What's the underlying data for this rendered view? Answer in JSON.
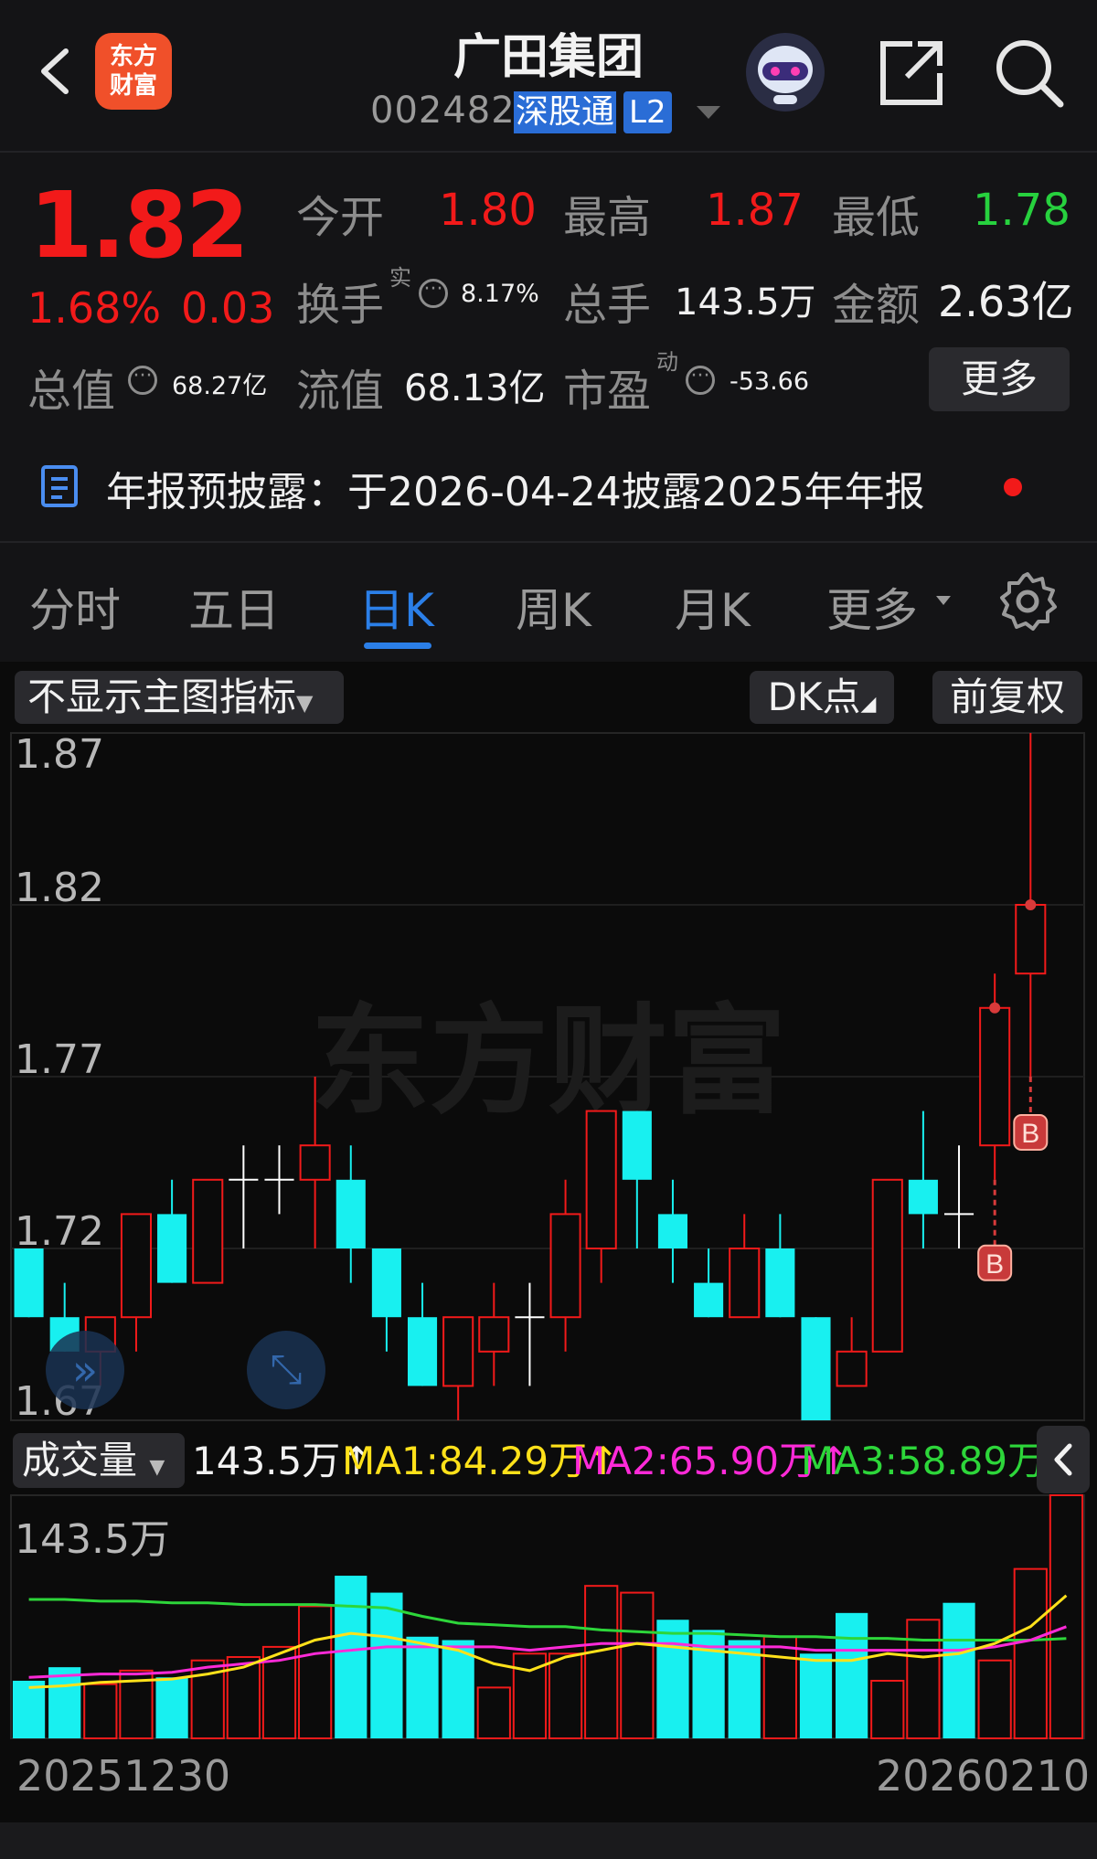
{
  "header": {
    "logo_text_1": "东方",
    "logo_text_2": "财富",
    "title": "广田集团",
    "code": "002482",
    "badge": "深股通",
    "level": "L2"
  },
  "quote": {
    "price": "1.82",
    "pct": "1.68%",
    "change": "0.03",
    "open_label": "今开",
    "open": "1.80",
    "high_label": "最高",
    "high": "1.87",
    "low_label": "最低",
    "low": "1.78",
    "turnover_label": "换手",
    "turnover_sup": "实",
    "turnover": "8.17%",
    "volume_label": "总手",
    "volume": "143.5万",
    "amount_label": "金额",
    "amount": "2.63亿",
    "mktcap_label": "总值",
    "mktcap": "68.27亿",
    "float_label": "流值",
    "float_cap": "68.13亿",
    "pe_label": "市盈",
    "pe_sup": "动",
    "pe": "-53.66",
    "more_label": "更多"
  },
  "notice": {
    "text": "年报预披露：于2026-04-24披露2025年年报"
  },
  "tabs": [
    "分时",
    "五日",
    "日K",
    "周K",
    "月K",
    "更多"
  ],
  "active_tab": "日K",
  "chart_controls": {
    "indicator": "不显示主图指标",
    "dk": "DK点",
    "adjust": "前复权",
    "watermark": "东方财富",
    "b_marker": "B"
  },
  "volume_panel": {
    "selector": "成交量",
    "current": "143.5万↑",
    "ma1": "MA1:84.29万↑",
    "ma2": "MA2:65.90万↑",
    "ma3": "MA3:58.89万↑",
    "max_label": "143.5万"
  },
  "dates": {
    "start": "20251230",
    "end": "20260210"
  },
  "colors": {
    "up": "#f21a1a",
    "down": "#18f0f0",
    "ma1": "#ffe11a",
    "ma2": "#ff2ad8",
    "ma3": "#2dd63a",
    "accent": "#2b7fe8"
  },
  "chart_data": {
    "type": "candlestick",
    "y_ticks": [
      "1.87",
      "1.82",
      "1.77",
      "1.72",
      "1.67"
    ],
    "ylim": [
      1.67,
      1.87
    ],
    "candles": [
      {
        "o": 1.72,
        "h": 1.72,
        "l": 1.7,
        "c": 1.7
      },
      {
        "o": 1.7,
        "h": 1.71,
        "l": 1.69,
        "c": 1.69
      },
      {
        "o": 1.69,
        "h": 1.7,
        "l": 1.68,
        "c": 1.7
      },
      {
        "o": 1.7,
        "h": 1.73,
        "l": 1.69,
        "c": 1.73
      },
      {
        "o": 1.73,
        "h": 1.74,
        "l": 1.71,
        "c": 1.71
      },
      {
        "o": 1.71,
        "h": 1.74,
        "l": 1.71,
        "c": 1.74
      },
      {
        "o": 1.74,
        "h": 1.75,
        "l": 1.72,
        "c": 1.74
      },
      {
        "o": 1.74,
        "h": 1.75,
        "l": 1.73,
        "c": 1.74
      },
      {
        "o": 1.74,
        "h": 1.77,
        "l": 1.72,
        "c": 1.75
      },
      {
        "o": 1.74,
        "h": 1.75,
        "l": 1.71,
        "c": 1.72
      },
      {
        "o": 1.72,
        "h": 1.72,
        "l": 1.69,
        "c": 1.7
      },
      {
        "o": 1.7,
        "h": 1.71,
        "l": 1.68,
        "c": 1.68
      },
      {
        "o": 1.68,
        "h": 1.7,
        "l": 1.67,
        "c": 1.7
      },
      {
        "o": 1.69,
        "h": 1.71,
        "l": 1.68,
        "c": 1.7
      },
      {
        "o": 1.7,
        "h": 1.71,
        "l": 1.68,
        "c": 1.7
      },
      {
        "o": 1.7,
        "h": 1.74,
        "l": 1.69,
        "c": 1.73
      },
      {
        "o": 1.72,
        "h": 1.76,
        "l": 1.71,
        "c": 1.76
      },
      {
        "o": 1.76,
        "h": 1.76,
        "l": 1.72,
        "c": 1.74
      },
      {
        "o": 1.73,
        "h": 1.74,
        "l": 1.71,
        "c": 1.72
      },
      {
        "o": 1.71,
        "h": 1.72,
        "l": 1.7,
        "c": 1.7
      },
      {
        "o": 1.7,
        "h": 1.73,
        "l": 1.7,
        "c": 1.72
      },
      {
        "o": 1.72,
        "h": 1.73,
        "l": 1.7,
        "c": 1.7
      },
      {
        "o": 1.7,
        "h": 1.7,
        "l": 1.67,
        "c": 1.67
      },
      {
        "o": 1.68,
        "h": 1.7,
        "l": 1.68,
        "c": 1.69
      },
      {
        "o": 1.69,
        "h": 1.74,
        "l": 1.69,
        "c": 1.74
      },
      {
        "o": 1.74,
        "h": 1.76,
        "l": 1.72,
        "c": 1.73
      },
      {
        "o": 1.73,
        "h": 1.75,
        "l": 1.72,
        "c": 1.73
      },
      {
        "o": 1.75,
        "h": 1.8,
        "l": 1.74,
        "c": 1.79
      },
      {
        "o": 1.8,
        "h": 1.87,
        "l": 1.77,
        "c": 1.82
      }
    ],
    "volume": {
      "max": "143.5万",
      "bars_wan": [
        34,
        42,
        32,
        40,
        36,
        46,
        48,
        54,
        78,
        96,
        86,
        60,
        58,
        30,
        50,
        50,
        90,
        86,
        70,
        64,
        58,
        60,
        50,
        74,
        34,
        70,
        80,
        46,
        100,
        143.5
      ],
      "bars_up": [
        false,
        false,
        true,
        true,
        false,
        true,
        true,
        true,
        true,
        false,
        false,
        false,
        false,
        true,
        true,
        true,
        true,
        true,
        false,
        false,
        false,
        true,
        false,
        false,
        true,
        true,
        false,
        true,
        true,
        true
      ],
      "ma1": [
        30,
        31,
        33,
        34,
        35,
        38,
        42,
        50,
        58,
        62,
        60,
        56,
        52,
        44,
        40,
        48,
        52,
        56,
        54,
        52,
        50,
        48,
        46,
        46,
        50,
        48,
        50,
        56,
        66,
        84.29
      ],
      "ma2": [
        36,
        37,
        38,
        38,
        39,
        42,
        44,
        46,
        50,
        52,
        54,
        54,
        54,
        54,
        52,
        54,
        56,
        56,
        56,
        54,
        54,
        54,
        52,
        52,
        52,
        52,
        52,
        54,
        58,
        65.9
      ],
      "ma3": [
        82,
        82,
        81,
        81,
        80,
        80,
        79,
        79,
        79,
        78,
        77,
        72,
        68,
        67,
        66,
        66,
        64,
        63,
        62,
        62,
        61,
        60,
        60,
        59,
        59,
        58,
        58,
        58,
        58,
        58.89
      ]
    }
  }
}
